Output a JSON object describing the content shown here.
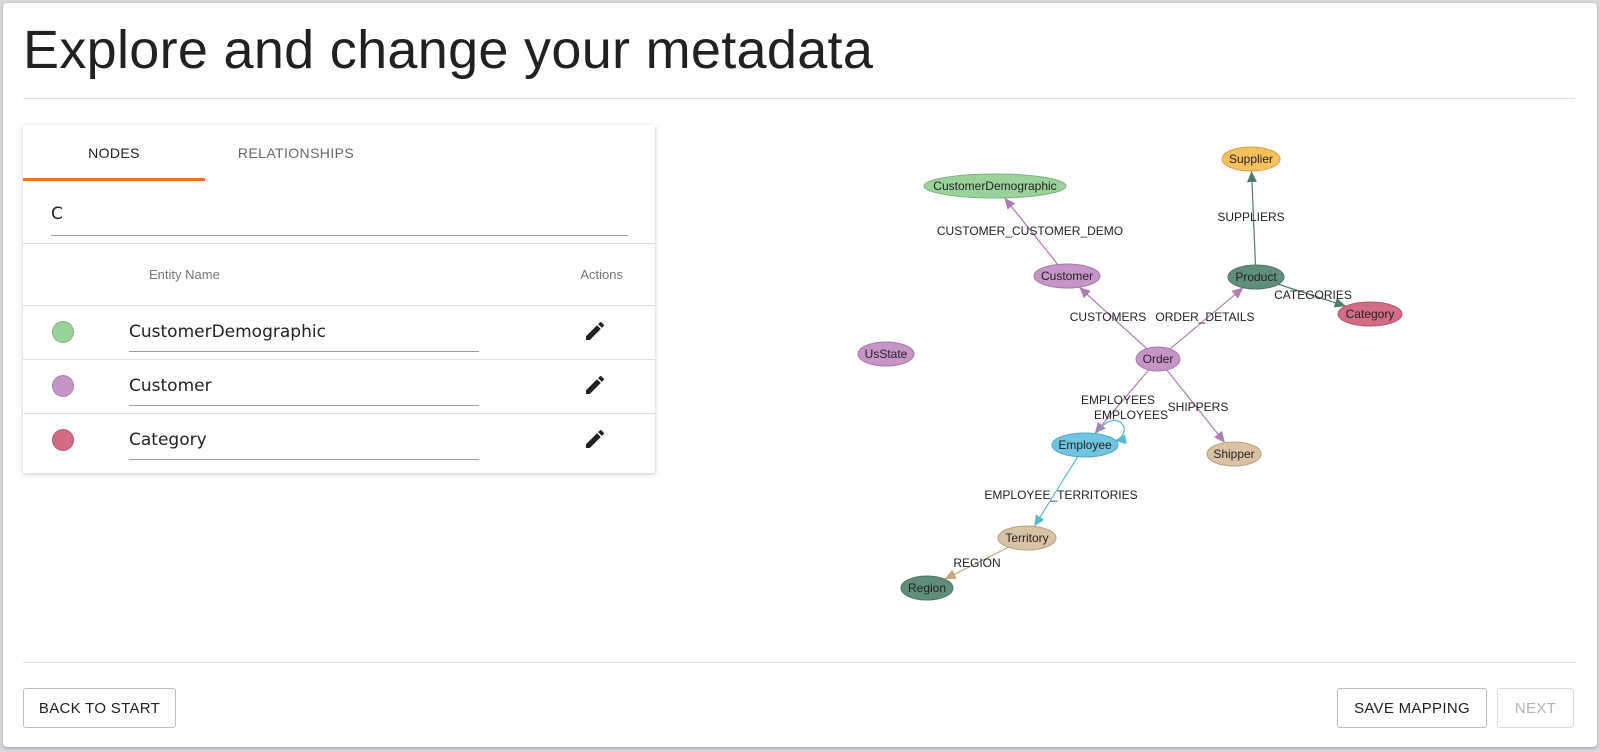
{
  "page": {
    "title": "Explore and change your metadata"
  },
  "tabs": [
    {
      "label": "NODES",
      "active": true
    },
    {
      "label": "RELATIONSHIPS",
      "active": false
    }
  ],
  "search": {
    "value": "C"
  },
  "table": {
    "headers": {
      "name": "Entity Name",
      "actions": "Actions"
    },
    "rows": [
      {
        "name": "CustomerDemographic",
        "color": "#9bd29c"
      },
      {
        "name": "Customer",
        "color": "#c695c8"
      },
      {
        "name": "Category",
        "color": "#d26d85"
      }
    ],
    "action_icon": "pencil-icon"
  },
  "graph": {
    "colors": {
      "green_light": "#9bd29c",
      "purple": "#c695c8",
      "pink": "#d26d85",
      "dark_green": "#5f8e7a",
      "blue": "#6fc5e0",
      "tan": "#d8c2a3",
      "yellow": "#f8c15e"
    },
    "nodes": [
      {
        "id": "customerdemographic",
        "label": "CustomerDemographic",
        "color": "#9bd29c",
        "stroke": "#7cb37d"
      },
      {
        "id": "supplier",
        "label": "Supplier",
        "color": "#f8c15e",
        "stroke": "#d8a24a"
      },
      {
        "id": "customer",
        "label": "Customer",
        "color": "#c695c8",
        "stroke": "#a87aaa"
      },
      {
        "id": "product",
        "label": "Product",
        "color": "#5f8e7a",
        "stroke": "#4b7463"
      },
      {
        "id": "category",
        "label": "Category",
        "color": "#d26d85",
        "stroke": "#b4566d"
      },
      {
        "id": "usstate",
        "label": "UsState",
        "color": "#c695c8",
        "stroke": "#a87aaa"
      },
      {
        "id": "order",
        "label": "Order",
        "color": "#c695c8",
        "stroke": "#a87aaa"
      },
      {
        "id": "employee",
        "label": "Employee",
        "color": "#6fc5e0",
        "stroke": "#52a8c4"
      },
      {
        "id": "shipper",
        "label": "Shipper",
        "color": "#d8c2a3",
        "stroke": "#b8a283"
      },
      {
        "id": "territory",
        "label": "Territory",
        "color": "#d8c2a3",
        "stroke": "#b8a283"
      },
      {
        "id": "region",
        "label": "Region",
        "color": "#5f8e7a",
        "stroke": "#4b7463"
      }
    ],
    "edges": [
      {
        "label": "CUSTOMER_CUSTOMER_DEMO",
        "from": "customer",
        "to": "customerdemographic",
        "color": "#b07ab4"
      },
      {
        "label": "SUPPLIERS",
        "from": "product",
        "to": "supplier",
        "color": "#4f7d69"
      },
      {
        "label": "CATEGORIES",
        "from": "product",
        "to": "category",
        "color": "#4f7d69"
      },
      {
        "label": "CUSTOMERS",
        "from": "order",
        "to": "customer",
        "color": "#b07ab4"
      },
      {
        "label": "ORDER_DETAILS",
        "from": "order",
        "to": "product",
        "color": "#b07ab4"
      },
      {
        "label": "EMPLOYEES",
        "from": "order",
        "to": "employee",
        "color": "#b07ab4"
      },
      {
        "label": "EMPLOYEES",
        "from": "employee",
        "to": "employee",
        "color": "#5ab8d4"
      },
      {
        "label": "SHIPPERS",
        "from": "order",
        "to": "shipper",
        "color": "#b07ab4"
      },
      {
        "label": "EMPLOYEE_TERRITORIES",
        "from": "employee",
        "to": "territory",
        "color": "#5ab8d4"
      },
      {
        "label": "REGION",
        "from": "territory",
        "to": "region",
        "color": "#c2a67d"
      }
    ]
  },
  "footer": {
    "back_label": "BACK TO START",
    "save_label": "SAVE MAPPING",
    "next_label": "NEXT",
    "next_disabled": true
  }
}
